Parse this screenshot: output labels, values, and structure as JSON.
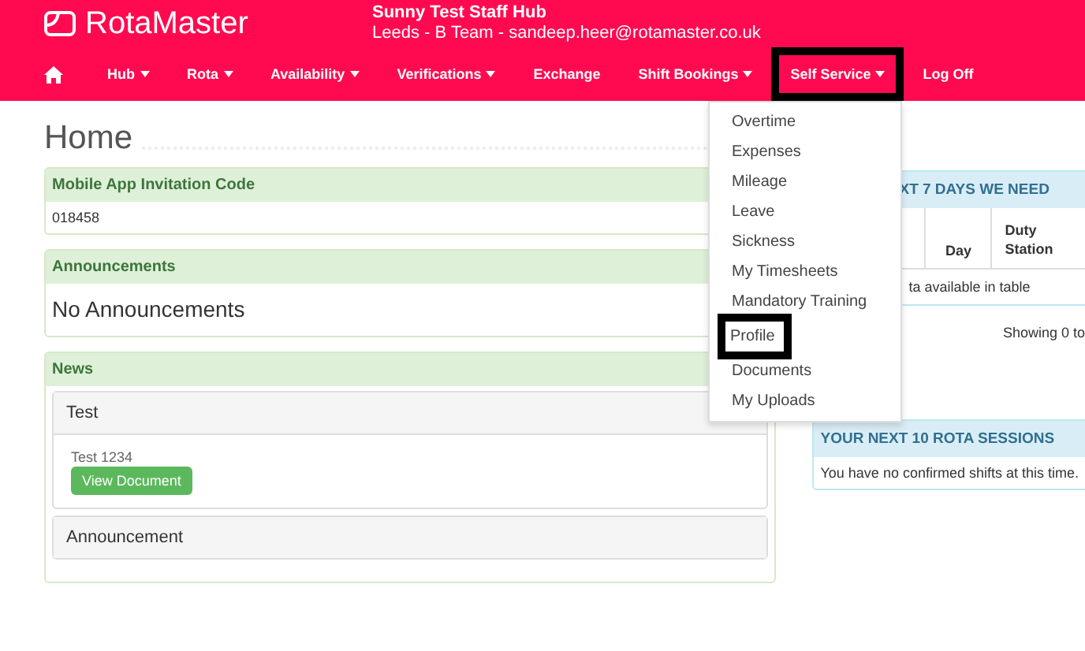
{
  "header": {
    "logo": "RotaMaster",
    "title": "Sunny Test Staff Hub",
    "subtitle": "Leeds - B Team - sandeep.heer@rotamaster.co.uk"
  },
  "nav": [
    {
      "label": "Hub",
      "dropdown": true,
      "highlighted": false
    },
    {
      "label": "Rota",
      "dropdown": true,
      "highlighted": false
    },
    {
      "label": "Availability",
      "dropdown": true,
      "highlighted": false
    },
    {
      "label": "Verifications",
      "dropdown": true,
      "highlighted": false
    },
    {
      "label": "Exchange",
      "dropdown": false,
      "highlighted": false
    },
    {
      "label": "Shift Bookings",
      "dropdown": true,
      "highlighted": false
    },
    {
      "label": "Self Service",
      "dropdown": true,
      "highlighted": true
    },
    {
      "label": "Log Off",
      "dropdown": false,
      "highlighted": false
    }
  ],
  "dropdown_menu": [
    {
      "label": "Overtime",
      "highlighted": false
    },
    {
      "label": "Expenses",
      "highlighted": false
    },
    {
      "label": "Mileage",
      "highlighted": false
    },
    {
      "label": "Leave",
      "highlighted": false
    },
    {
      "label": "Sickness",
      "highlighted": false
    },
    {
      "label": "My Timesheets",
      "highlighted": false
    },
    {
      "label": "Mandatory Training",
      "highlighted": false
    },
    {
      "label": "Profile",
      "highlighted": true
    },
    {
      "label": "Documents",
      "highlighted": false
    },
    {
      "label": "My Uploads",
      "highlighted": false
    }
  ],
  "page_title": "Home",
  "invitation": {
    "heading": "Mobile App Invitation Code",
    "code": "018458"
  },
  "announcements": {
    "heading": "Announcements",
    "message": "No Announcements"
  },
  "news": {
    "heading": "News",
    "items": [
      {
        "title": "Test",
        "body": "Test 1234",
        "button": "View Document",
        "expanded": true
      },
      {
        "title": "Announcement",
        "expanded": false
      }
    ]
  },
  "next_days": {
    "heading": "XT 7 DAYS WE NEED",
    "columns": [
      "Day",
      "Duty Station"
    ],
    "empty_row": "ta available in table",
    "info": "Showing 0 to"
  },
  "rota_sessions": {
    "heading": "YOUR NEXT 10 ROTA SESSIONS",
    "message": "You have no confirmed shifts at this time."
  }
}
